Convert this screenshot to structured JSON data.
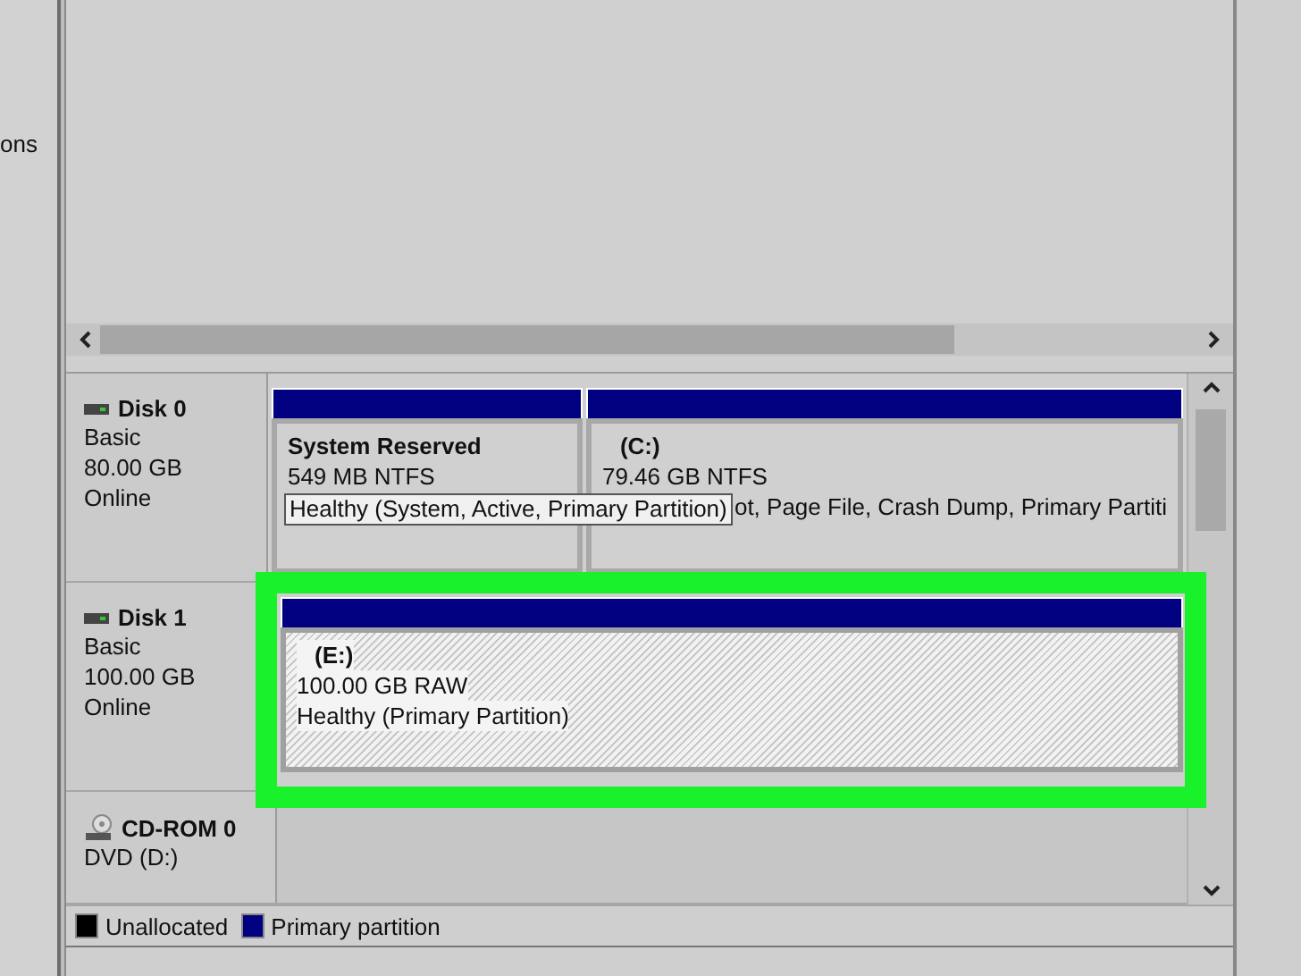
{
  "side_pane": {
    "text": "ons"
  },
  "disks": [
    {
      "name": "Disk 0",
      "kind": "disk",
      "lines": [
        "Basic",
        "80.00 GB",
        "Online"
      ],
      "highlighted": false,
      "tooltip": "Healthy (System, Active, Primary Partition)",
      "partitions": [
        {
          "title": "System Reserved",
          "size": "549 MB NTFS",
          "kind": "primary",
          "selected": false
        },
        {
          "title": "(C:)",
          "size": "79.46 GB NTFS",
          "status": "ot, Page File, Crash Dump, Primary Partiti",
          "kind": "primary",
          "selected": false
        }
      ]
    },
    {
      "name": "Disk 1",
      "kind": "disk",
      "lines": [
        "Basic",
        "100.00 GB",
        "Online"
      ],
      "highlighted": true,
      "partitions": [
        {
          "title": "(E:)",
          "size": "100.00 GB RAW",
          "status": "Healthy (Primary Partition)",
          "kind": "primary",
          "selected": true
        }
      ]
    },
    {
      "name": "CD-ROM 0",
      "kind": "cdrom",
      "lines": [
        "DVD (D:)"
      ],
      "highlighted": false
    }
  ],
  "legend": [
    {
      "label": "Unallocated",
      "color": "#000000"
    },
    {
      "label": "Primary partition",
      "color": "#000080"
    }
  ]
}
